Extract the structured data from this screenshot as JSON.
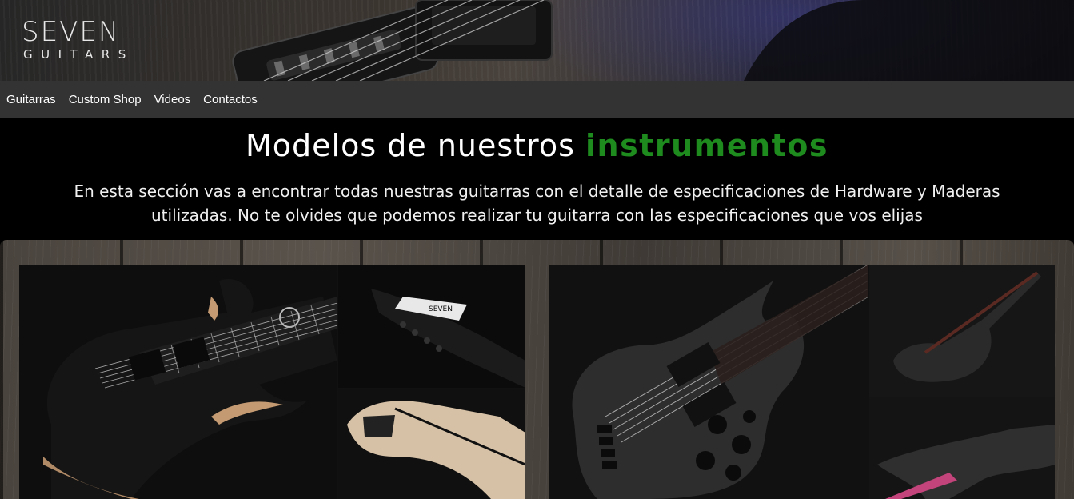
{
  "brand": {
    "logo_top": "SEVEN",
    "logo_bottom": "GUITARS"
  },
  "nav": {
    "items": [
      {
        "label": "Guitarras"
      },
      {
        "label": "Custom Shop"
      },
      {
        "label": "Videos"
      },
      {
        "label": "Contactos"
      }
    ]
  },
  "main": {
    "title_plain": "Modelos de nuestros",
    "title_accent": "instrumentos",
    "intro": "En esta sección vas a encontrar todas nuestras guitarras con el detalle de especificaciones de Hardware y Maderas utilizadas. No te olvides que podemos realizar tu guitarra con las especificaciones que vos elijas"
  },
  "gallery": {
    "guitar_headstock_label": "SEVEN"
  },
  "colors": {
    "accent": "#1e8b1e",
    "nav_bg": "#333333",
    "page_bg": "#000000"
  }
}
